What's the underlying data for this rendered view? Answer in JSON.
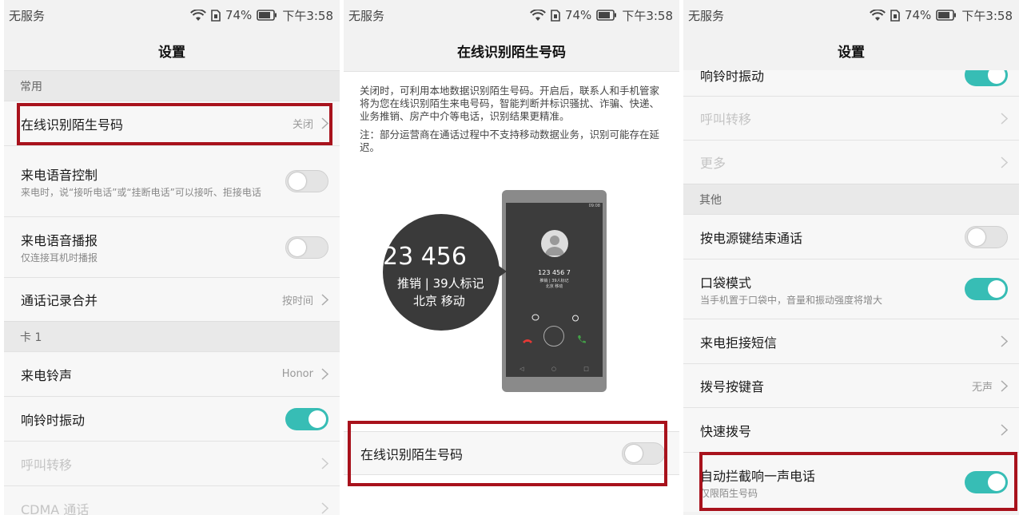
{
  "status": {
    "carrier": "无服务",
    "battery": "74%",
    "time": "下午3:58"
  },
  "panel1": {
    "title": "设置",
    "section_common": "常用",
    "online_id": {
      "title": "在线识别陌生号码",
      "value": "关闭"
    },
    "voice_control": {
      "title": "来电语音控制",
      "sub": "来电时，说“接听电话”或“挂断电话”可以接听、拒接电话"
    },
    "voice_broadcast": {
      "title": "来电语音播报",
      "sub": "仅连接耳机时播报"
    },
    "call_merge": {
      "title": "通话记录合并",
      "value": "按时间"
    },
    "section_card1": "卡 1",
    "ringtone": {
      "title": "来电铃声",
      "value": "Honor"
    },
    "vibrate": {
      "title": "响铃时振动"
    },
    "forward": {
      "title": "呼叫转移"
    },
    "cdma": {
      "title": "CDMA 通话"
    }
  },
  "panel2": {
    "title": "在线识别陌生号码",
    "desc1": "关闭时，可利用本地数据识别陌生号码。开启后，联系人和手机管家将为您在线识别陌生来电号码，智能判断并标识骚扰、诈骗、快递、业务推销、房产中介等电话，识别结果更精准。",
    "desc2": "注：部分运营商在通话过程中不支持移动数据业务，识别可能存在延迟。",
    "illustration": {
      "big_number": "23 456",
      "big_tag": "推销 | 39人标记",
      "big_location": "北京 移动",
      "phone_number": "123 456 7",
      "phone_tag": "推销 | 39人标记",
      "phone_location": "北京 移动",
      "phone_time": "09:08"
    },
    "toggle_label": "在线识别陌生号码"
  },
  "panel3": {
    "title": "设置",
    "vibrate_partial": "响铃时振动",
    "forward": "呼叫转移",
    "more": "更多",
    "section_other": "其他",
    "power_end": {
      "title": "按电源键结束通话"
    },
    "pocket": {
      "title": "口袋模式",
      "sub": "当手机置于口袋中，音量和振动强度将增大"
    },
    "reject_sms": {
      "title": "来电拒接短信"
    },
    "dial_tone": {
      "title": "拨号按键音",
      "value": "无声"
    },
    "speed_dial": {
      "title": "快速拨号"
    },
    "block_one_ring": {
      "title": "自动拦截响一声电话",
      "sub": "仅限陌生号码"
    }
  },
  "colors": {
    "accent_toggle": "#37bdb5",
    "highlight_box": "#a8121c"
  },
  "icons": [
    "wifi-icon",
    "sim-card-icon",
    "battery-icon",
    "chevron-right-icon",
    "avatar-icon",
    "hangup-icon",
    "answer-icon",
    "message-icon",
    "alarm-icon"
  ]
}
